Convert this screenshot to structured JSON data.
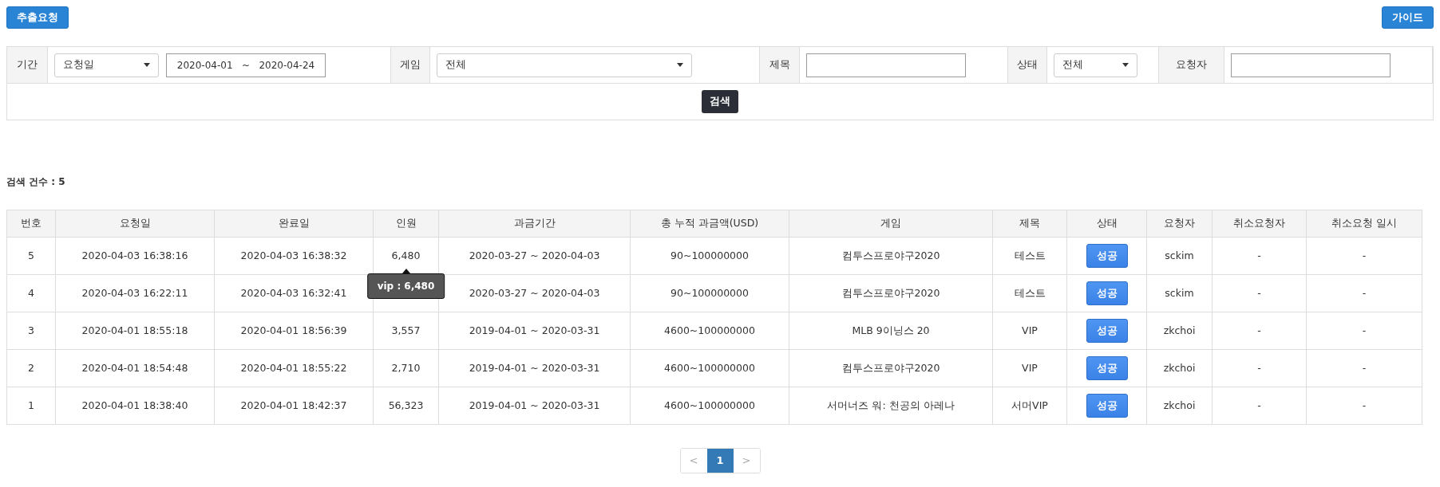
{
  "top_buttons": [
    {
      "label": "추출요청",
      "kind": "primary"
    },
    {
      "label": "가이드",
      "kind": "primary"
    }
  ],
  "filters": [
    {
      "label": "기간",
      "controls": [
        {
          "kind": "select",
          "value": "요청일"
        },
        {
          "kind": "daterange",
          "value": "2020-04-01   ~   2020-04-24"
        }
      ]
    },
    {
      "label": "게임",
      "controls": [
        {
          "kind": "select",
          "value": "전체"
        }
      ]
    },
    {
      "label": "제목",
      "controls": [
        {
          "kind": "input"
        }
      ]
    },
    {
      "label": "상태",
      "controls": [
        {
          "kind": "select",
          "value": "전체"
        }
      ]
    },
    {
      "label": "요청자",
      "controls": [
        {
          "kind": "input"
        }
      ]
    }
  ],
  "search_button": "검색",
  "result_count": "검색 건수 : 5",
  "table": {
    "columns": [
      "번호",
      "요청일",
      "완료일",
      "인원",
      "과금기간",
      "총 누적 과금액(USD)",
      "게임",
      "제목",
      "상태",
      "요청자",
      "취소요청자",
      "취소요청 일시"
    ],
    "rows": [
      {
        "cells": [
          "5",
          "2020-04-03 16:38:16",
          "2020-04-03 16:38:32",
          "6,480",
          "2020-03-27 ~ 2020-04-03",
          "90~100000000",
          "컴투스프로야구2020",
          "테스트",
          "성공",
          "sckim",
          "-",
          "-"
        ],
        "tooltip": "vip : 6,480"
      },
      {
        "cells": [
          "4",
          "2020-04-03 16:22:11",
          "2020-04-03 16:32:41",
          "",
          "2020-03-27 ~ 2020-04-03",
          "90~100000000",
          "컴투스프로야구2020",
          "테스트",
          "성공",
          "sckim",
          "-",
          "-"
        ]
      },
      {
        "cells": [
          "3",
          "2020-04-01 18:55:18",
          "2020-04-01 18:56:39",
          "3,557",
          "2019-04-01 ~ 2020-03-31",
          "4600~100000000",
          "MLB 9이닝스 20",
          "VIP",
          "성공",
          "zkchoi",
          "-",
          "-"
        ]
      },
      {
        "cells": [
          "2",
          "2020-04-01 18:54:48",
          "2020-04-01 18:55:22",
          "2,710",
          "2019-04-01 ~ 2020-03-31",
          "4600~100000000",
          "컴투스프로야구2020",
          "VIP",
          "성공",
          "zkchoi",
          "-",
          "-"
        ]
      },
      {
        "cells": [
          "1",
          "2020-04-01 18:38:40",
          "2020-04-01 18:42:37",
          "56,323",
          "2019-04-01 ~ 2020-03-31",
          "4600~100000000",
          "서머너즈 워: 천공의 아레나",
          "서머VIP",
          "성공",
          "zkchoi",
          "-",
          "-"
        ]
      }
    ]
  },
  "pagination": {
    "prev": "<",
    "pages": [
      {
        "label": "1",
        "selected": true
      }
    ],
    "next": ">"
  }
}
